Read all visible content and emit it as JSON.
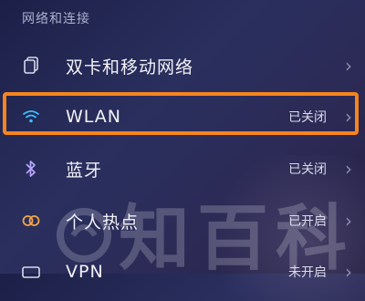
{
  "section": {
    "title": "网络和连接"
  },
  "rows": [
    {
      "icon": "sim-card-icon",
      "label": "双卡和移动网络",
      "status": ""
    },
    {
      "icon": "wifi-icon",
      "label": "WLAN",
      "status": "已关闭"
    },
    {
      "icon": "bluetooth-icon",
      "label": "蓝牙",
      "status": "已关闭"
    },
    {
      "icon": "hotspot-icon",
      "label": "个人热点",
      "status": "已开启"
    },
    {
      "icon": "vpn-icon",
      "label": "VPN",
      "status": "未开启"
    }
  ],
  "watermark": {
    "text": "知百科"
  },
  "colors": {
    "highlight": "#f7841f",
    "wifi_icon": "#37c0ff",
    "hotspot_icon": "#f2a44a"
  }
}
